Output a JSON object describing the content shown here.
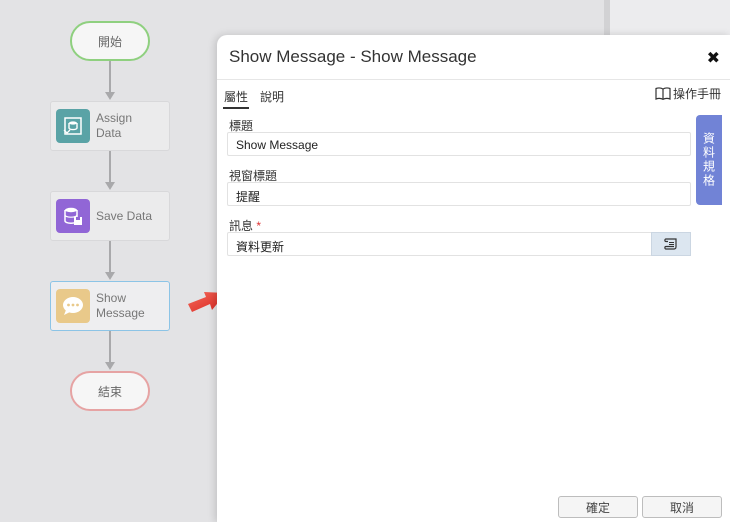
{
  "flow": {
    "start_label": "開始",
    "end_label": "結束",
    "nodes": [
      {
        "label": "Assign\nData",
        "icon": "assign-data-icon",
        "color": "#5aa3a6"
      },
      {
        "label": "Save Data",
        "icon": "save-data-icon",
        "color": "#9166d6"
      },
      {
        "label": "Show\nMessage",
        "icon": "chat-bubble-icon",
        "color": "#e9c98a"
      }
    ]
  },
  "dialog": {
    "title": "Show Message - Show Message",
    "close_symbol": "✖",
    "tabs": [
      {
        "label": "屬性",
        "active": true
      },
      {
        "label": "說明",
        "active": false
      }
    ],
    "manual_label": "操作手冊",
    "side_tab_label": "資料規格",
    "fields": [
      {
        "label": "標題",
        "value": "Show Message",
        "required": false
      },
      {
        "label": "視窗標題",
        "value": "提醒",
        "required": false
      },
      {
        "label": "訊息",
        "value": "資料更新",
        "required": true
      }
    ],
    "required_mark": "*",
    "ok_label": "確定",
    "cancel_label": "取消"
  },
  "colors": {
    "start_border": "#8fd07f",
    "end_border": "#e6a3a3",
    "active_node_border": "#8cc4e6",
    "side_tab": "#7183d6",
    "pointer_arrow": "#e8312f"
  }
}
